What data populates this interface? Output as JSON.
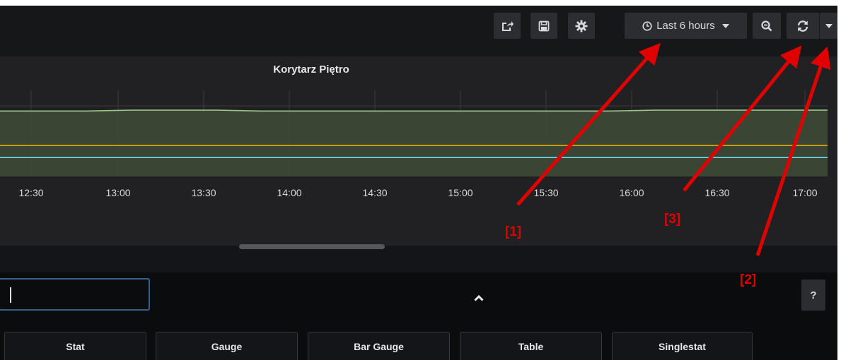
{
  "toolbar": {
    "time_range_label": "Last 6 hours"
  },
  "panel": {
    "title": "Korytarz Piętro"
  },
  "chart_data": {
    "type": "line",
    "title": "Korytarz Piętro",
    "x_ticks": [
      "12:30",
      "13:00",
      "13:30",
      "14:00",
      "14:30",
      "15:00",
      "15:30",
      "16:00",
      "16:30",
      "17:00"
    ],
    "grid": true,
    "series": [
      {
        "color": "#9ac48a",
        "values": [
          0.76,
          0.76,
          0.76,
          0.77,
          0.77,
          0.77,
          0.76,
          0.76,
          0.76,
          0.76,
          0.76,
          0.76,
          0.76,
          0.76,
          0.76,
          0.77,
          0.77,
          0.77,
          0.77,
          0.77
        ]
      },
      {
        "color": "#e5ac0e",
        "values": [
          0.36,
          0.36,
          0.36,
          0.36,
          0.36,
          0.36,
          0.36,
          0.36,
          0.36,
          0.36,
          0.36,
          0.36,
          0.36,
          0.36,
          0.36,
          0.36,
          0.36,
          0.36,
          0.36,
          0.36
        ]
      },
      {
        "color": "#70dbed",
        "values": [
          0.22,
          0.22,
          0.22,
          0.22,
          0.22,
          0.22,
          0.22,
          0.22,
          0.22,
          0.22,
          0.22,
          0.22,
          0.22,
          0.22,
          0.22,
          0.22,
          0.22,
          0.22,
          0.22,
          0.22
        ]
      }
    ]
  },
  "editor": {
    "search_value": "",
    "help_label": "?",
    "visualizations": [
      "Stat",
      "Gauge",
      "Bar Gauge",
      "Table",
      "Singlestat"
    ]
  },
  "annotations": {
    "labels": [
      "[1]",
      "[3]",
      "[2]"
    ],
    "color": "#e00000"
  },
  "colors": {
    "background": "#111217",
    "panel": "#212124",
    "button": "#2b2d31",
    "accent_border": "#3a5f8a"
  },
  "icons": [
    "share-icon",
    "save-icon",
    "gear-icon",
    "clock-icon",
    "zoom-out-icon",
    "refresh-icon",
    "chevron-down-icon",
    "chevron-up-icon",
    "help-icon"
  ]
}
